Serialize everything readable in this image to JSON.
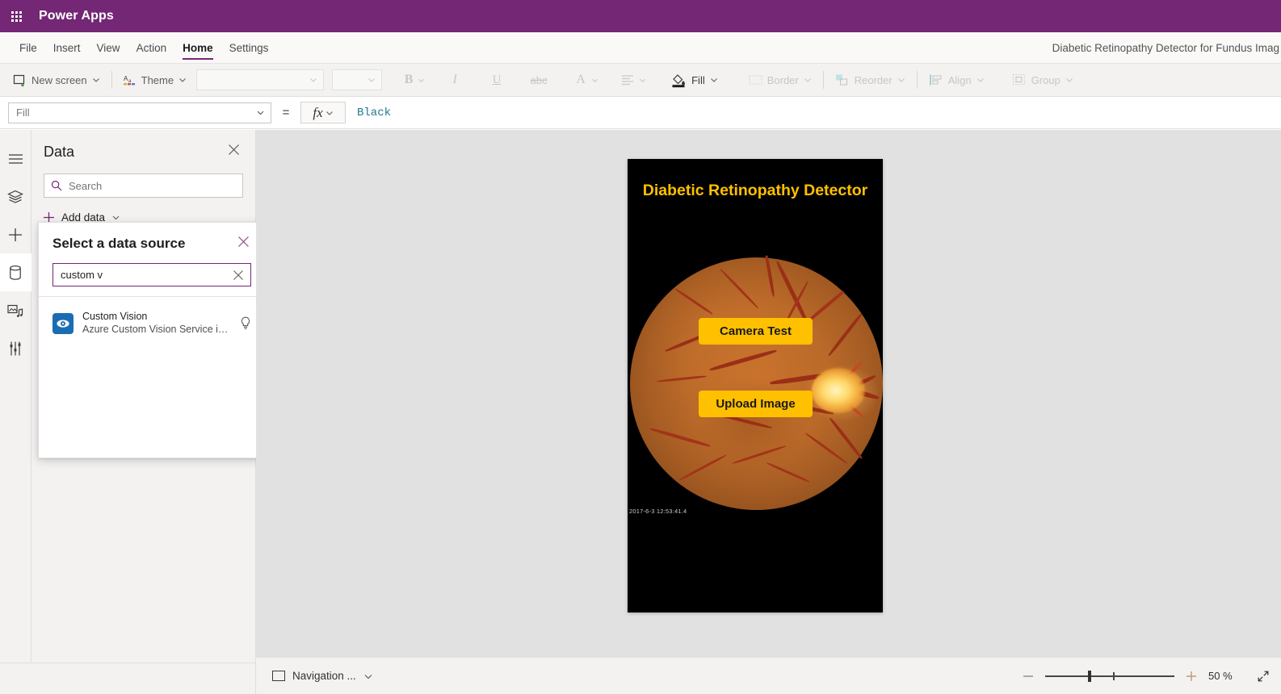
{
  "topbar": {
    "waffle_icon": "waffle-grid-icon",
    "brand": "Power Apps",
    "brand_color": "#742774"
  },
  "menubar": {
    "items": [
      {
        "label": "File",
        "active": false
      },
      {
        "label": "Insert",
        "active": false
      },
      {
        "label": "View",
        "active": false
      },
      {
        "label": "Action",
        "active": false
      },
      {
        "label": "Home",
        "active": true
      },
      {
        "label": "Settings",
        "active": false
      }
    ],
    "app_title": "Diabetic Retinopathy Detector for Fundus Imag"
  },
  "ribbon": {
    "new_screen": "New screen",
    "theme": "Theme",
    "font_family_value": "",
    "font_size_value": "",
    "bold": "B",
    "italic": "I",
    "underline": "U",
    "strikethrough": "abc",
    "font_color": "A",
    "align": "align-icon",
    "fill": "Fill",
    "border": "Border",
    "reorder": "Reorder",
    "align_label": "Align",
    "group": "Group"
  },
  "formulabar": {
    "property": "Fill",
    "equals": "=",
    "fx_label": "fx",
    "formula_value": "Black"
  },
  "rail": {
    "items": [
      {
        "name": "hamburger-icon",
        "selected": false
      },
      {
        "name": "tree-view-icon",
        "selected": false
      },
      {
        "name": "insert-plus-icon",
        "selected": false
      },
      {
        "name": "data-icon",
        "selected": true
      },
      {
        "name": "media-icon",
        "selected": false
      },
      {
        "name": "variables-icon",
        "selected": false
      }
    ]
  },
  "datapanel": {
    "title": "Data",
    "close_icon": "close-icon",
    "search_placeholder": "Search",
    "search_value": "",
    "add_data": "Add data"
  },
  "flyout": {
    "title": "Select a data source",
    "close_icon": "close-icon",
    "search_value": "custom v",
    "clear_icon": "clear-icon",
    "results": [
      {
        "name": "Custom Vision",
        "description": "Azure Custom Vision Service is a M...",
        "icon": "eye-icon",
        "icon_color": "#1a6cb5",
        "info_icon": "lightbulb-icon"
      }
    ]
  },
  "canvas": {
    "screen": {
      "background": "#000000",
      "title": "Diabetic Retinopathy Detector",
      "title_color": "#FFC000",
      "image_timestamp": "2017-6-3  12:53:41.4",
      "buttons": [
        {
          "label": "Camera Test",
          "fill": "#FFC000"
        },
        {
          "label": "Upload Image",
          "fill": "#FFC000"
        }
      ]
    }
  },
  "statusbar": {
    "navigation_label": "Navigation ...",
    "zoom_out_icon": "minus-icon",
    "zoom_in_icon": "plus-icon",
    "zoom_percent": "50  %",
    "expand_icon": "expand-icon"
  }
}
